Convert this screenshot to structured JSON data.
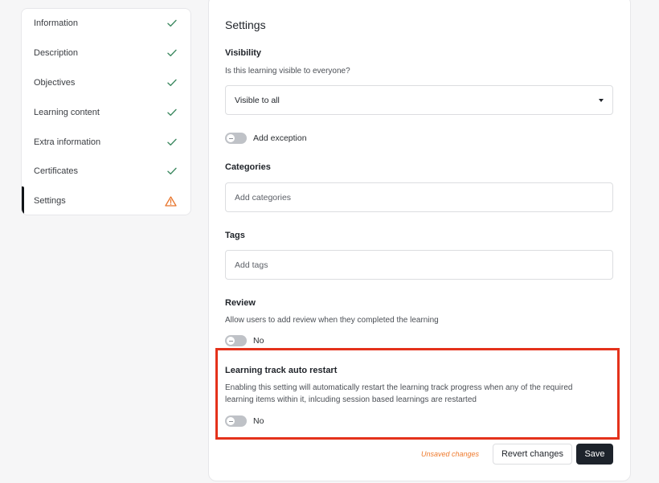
{
  "sidebar": {
    "items": [
      {
        "label": "Information",
        "status": "check-icon"
      },
      {
        "label": "Description",
        "status": "check-icon"
      },
      {
        "label": "Objectives",
        "status": "check-icon"
      },
      {
        "label": "Learning content",
        "status": "check-icon"
      },
      {
        "label": "Extra information",
        "status": "check-icon"
      },
      {
        "label": "Certificates",
        "status": "check-icon"
      },
      {
        "label": "Settings",
        "status": "warning-icon",
        "active": true
      }
    ]
  },
  "settings": {
    "title": "Settings",
    "visibility": {
      "heading": "Visibility",
      "description": "Is this learning visible to everyone?",
      "selected": "Visible to all",
      "exception_label": "Add exception"
    },
    "categories": {
      "heading": "Categories",
      "placeholder": "Add categories"
    },
    "tags": {
      "heading": "Tags",
      "placeholder": "Add tags"
    },
    "review": {
      "heading": "Review",
      "description": "Allow users to add review when they completed the learning",
      "toggle_label": "No"
    },
    "auto_restart": {
      "heading": "Learning track auto restart",
      "description_line1": "Enabling this setting will automatically restart the learning track progress when any of the required",
      "description_line2": "learning items within it, inlcuding session based learnings are restarted",
      "toggle_label": "No"
    }
  },
  "footer": {
    "unsaved": "Unsaved changes",
    "revert_label": "Revert changes",
    "save_label": "Save"
  },
  "colors": {
    "check": "#3f8a62",
    "warning": "#e8742a",
    "highlight": "#e4321b",
    "primary_button": "#1d232b"
  }
}
